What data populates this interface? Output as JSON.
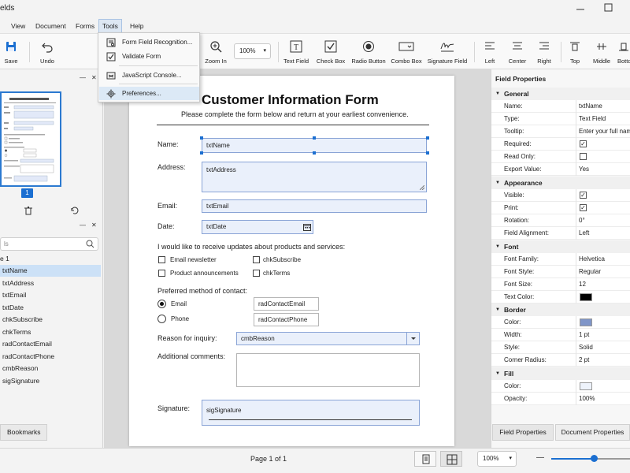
{
  "window": {
    "title": "elds"
  },
  "menubar": {
    "items": [
      {
        "label": "View"
      },
      {
        "label": "Document"
      },
      {
        "label": "Forms"
      },
      {
        "label": "Tools"
      },
      {
        "label": "Help"
      }
    ]
  },
  "tools_menu": {
    "items": [
      {
        "label": "Form Field Recognition...",
        "icon": "form-recognition-icon"
      },
      {
        "label": "Validate Form",
        "icon": "checkbox-icon"
      },
      {
        "label": "JavaScript Console...",
        "icon": "console-icon"
      },
      {
        "label": "Preferences...",
        "icon": "gear-icon"
      }
    ]
  },
  "toolbar": {
    "save": "Save",
    "undo": "Undo",
    "zoom_in": "Zoom In",
    "zoom_value": "100%",
    "text_field": "Text Field",
    "check_box": "Check Box",
    "radio_button": "Radio Button",
    "combo_box": "Combo Box",
    "signature_field": "Signature Field",
    "left": "Left",
    "center": "Center",
    "right": "Right",
    "top": "Top",
    "middle": "Middle",
    "bottom": "Botto"
  },
  "left_panel": {
    "page_badge": "1",
    "search_placeholder": "ls",
    "tree_root": "e 1",
    "fields": [
      "txtName",
      "txtAddress",
      "txtEmail",
      "txtDate",
      "chkSubscribe",
      "chkTerms",
      "radContactEmail",
      "radContactPhone",
      "cmbReason",
      "sigSignature"
    ],
    "selected_index": 0,
    "bookmarks_tab": "Bookmarks"
  },
  "form": {
    "title": "Customer Information Form",
    "subtitle": "Please complete the form below and return at your earliest convenience.",
    "name_label": "Name:",
    "name_field": "txtName",
    "address_label": "Address:",
    "address_field": "txtAddress",
    "email_label": "Email:",
    "email_field": "txtEmail",
    "date_label": "Date:",
    "date_field": "txtDate",
    "updates_question": "I would like to receive updates about products and services:",
    "opt_newsletter": "Email newsletter",
    "opt_newsletter_field": "chkSubscribe",
    "opt_announce": "Product announcements",
    "opt_announce_field": "chkTerms",
    "contact_question": "Preferred method of contact:",
    "contact_email": "Email",
    "contact_email_field": "radContactEmail",
    "contact_phone": "Phone",
    "contact_phone_field": "radContactPhone",
    "reason_label": "Reason for inquiry:",
    "reason_field": "cmbReason",
    "comments_label": "Additional comments:",
    "signature_label": "Signature:",
    "signature_field": "sigSignature"
  },
  "properties": {
    "title": "Field Properties",
    "sections": {
      "general": "General",
      "appearance": "Appearance",
      "font": "Font",
      "border": "Border",
      "fill": "Fill"
    },
    "general": {
      "name_k": "Name:",
      "name_v": "txtName",
      "type_k": "Type:",
      "type_v": "Text Field",
      "tooltip_k": "Tooltip:",
      "tooltip_v": "Enter your full nam",
      "required_k": "Required:",
      "readonly_k": "Read Only:",
      "export_k": "Export Value:",
      "export_v": "Yes"
    },
    "appearance": {
      "visible_k": "Visible:",
      "print_k": "Print:",
      "rotation_k": "Rotation:",
      "rotation_v": "0°",
      "align_k": "Field Alignment:",
      "align_v": "Left"
    },
    "font": {
      "family_k": "Font Family:",
      "family_v": "Helvetica",
      "style_k": "Font Style:",
      "style_v": "Regular",
      "size_k": "Font Size:",
      "size_v": "12",
      "color_k": "Text Color:"
    },
    "border": {
      "color_k": "Color:",
      "width_k": "Width:",
      "width_v": "1 pt",
      "style_k": "Style:",
      "style_v": "Solid",
      "radius_k": "Corner Radius:",
      "radius_v": "2 pt"
    },
    "fill": {
      "color_k": "Color:",
      "opacity_k": "Opacity:",
      "opacity_v": "100%"
    },
    "tab_field": "Field Properties",
    "tab_document": "Document Properties"
  },
  "status": {
    "page_indicator": "Page 1 of 1",
    "zoom_value": "100%",
    "zoom_slider_level": 0.54
  },
  "colors": {
    "accent": "#1b6fd1",
    "text_color_swatch": "#000000",
    "border_color_swatch": "#7f95c8",
    "fill_color_swatch": "#eef3fb"
  }
}
